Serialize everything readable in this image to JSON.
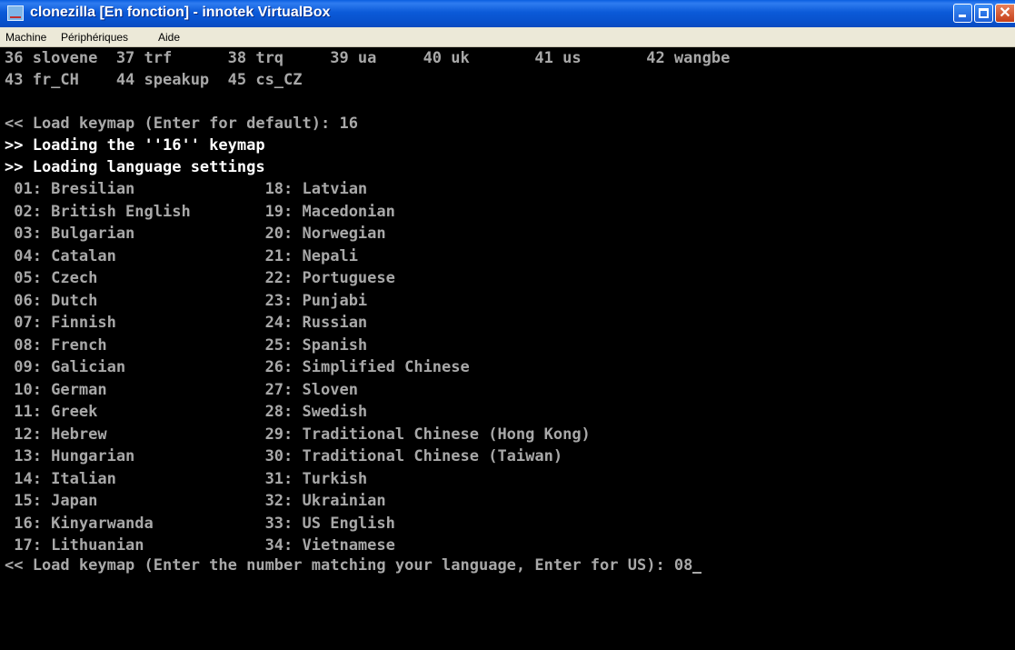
{
  "window": {
    "title": "clonezilla [En fonction] - innotek VirtualBox",
    "app_icon": "virtualbox-icon",
    "controls": {
      "minimize": "minimize-icon",
      "maximize": "maximize-icon",
      "close": "close-icon",
      "close_glyph": "✕"
    }
  },
  "menubar": {
    "items": [
      "Machine",
      "Périphériques",
      "Aide"
    ]
  },
  "console": {
    "keymap_list_tail": [
      "36 slovene  37 trf      38 trq     39 ua     40 uk       41 us       42 wangbe",
      "43 fr_CH    44 speakup  45 cs_CZ"
    ],
    "keymap_prompt": "<< Load keymap (Enter for default): 16",
    "msg_loading_keymap": ">> Loading the ''16'' keymap",
    "msg_loading_language": ">> Loading language settings",
    "language_rows": [
      " 01: Bresilian              18: Latvian",
      " 02: British English        19: Macedonian",
      " 03: Bulgarian              20: Norwegian",
      " 04: Catalan                21: Nepali",
      " 05: Czech                  22: Portuguese",
      " 06: Dutch                  23: Punjabi",
      " 07: Finnish                24: Russian",
      " 08: French                 25: Spanish",
      " 09: Galician               26: Simplified Chinese",
      " 10: German                 27: Sloven",
      " 11: Greek                  28: Swedish",
      " 12: Hebrew                 29: Traditional Chinese (Hong Kong)",
      " 13: Hungarian              30: Traditional Chinese (Taiwan)",
      " 14: Italian                31: Turkish",
      " 15: Japan                  32: Ukrainian",
      " 16: Kinyarwanda            33: US English",
      " 17: Lithuanian             34: Vietnamese"
    ],
    "language_prompt": "<< Load keymap (Enter the number matching your language, Enter for US): 08"
  }
}
